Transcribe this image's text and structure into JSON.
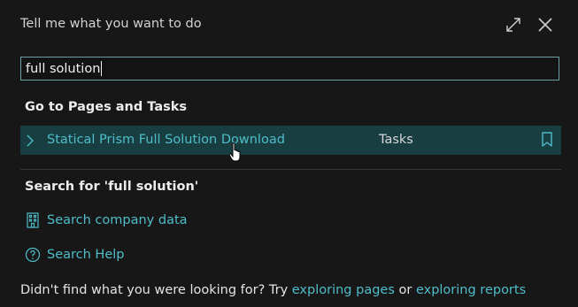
{
  "dialog": {
    "title": "Tell me what you want to do"
  },
  "search": {
    "value": "full solution"
  },
  "sections": {
    "pages_tasks_heading": "Go to Pages and Tasks",
    "search_for_heading": "Search for 'full solution'"
  },
  "result": {
    "name": "Statical Prism Full Solution Download",
    "category": "Tasks"
  },
  "actions": {
    "company_data": "Search company data",
    "help": "Search Help"
  },
  "footer": {
    "prefix": "Didn't find what you were looking for? Try ",
    "link_pages": "exploring pages",
    "middle": " or ",
    "link_reports": "exploring reports"
  },
  "colors": {
    "background": "#171717",
    "accent": "#4fbdc9",
    "selected_row": "#183e42",
    "input_border": "#6f9da0"
  },
  "icons": {
    "expand": "expand-icon",
    "close": "close-icon",
    "chevron": "chevron-right-icon",
    "bookmark": "bookmark-icon",
    "building": "building-icon",
    "help": "help-circle-icon",
    "cursor": "hand-pointer-icon"
  }
}
